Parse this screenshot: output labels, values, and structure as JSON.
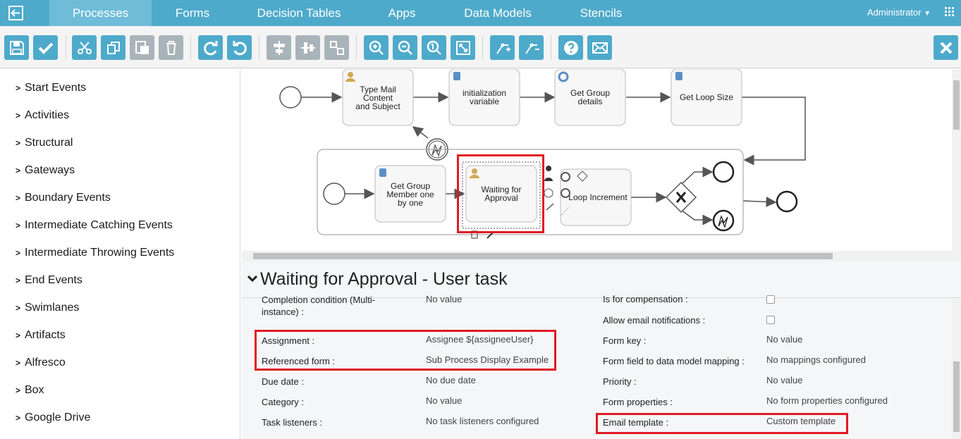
{
  "nav": {
    "tabs": [
      "Processes",
      "Forms",
      "Decision Tables",
      "Apps",
      "Data Models",
      "Stencils"
    ],
    "user": "Administrator"
  },
  "palette": {
    "items": [
      "Start Events",
      "Activities",
      "Structural",
      "Gateways",
      "Boundary Events",
      "Intermediate Catching Events",
      "Intermediate Throwing Events",
      "End Events",
      "Swimlanes",
      "Artifacts",
      "Alfresco",
      "Box",
      "Google Drive"
    ]
  },
  "diagram": {
    "task1": [
      "Type Mail",
      "Content",
      "and Subject"
    ],
    "task2": [
      "initialization",
      "variable"
    ],
    "task3": [
      "Get Group",
      "details"
    ],
    "task4": "Get Loop Size",
    "task5": [
      "Get Group",
      "Member one",
      "by one"
    ],
    "task6": [
      "Waiting for",
      "Approval"
    ],
    "task7": "Loop Increment"
  },
  "props": {
    "title": "Waiting for Approval - User task",
    "left": [
      {
        "label": "Completion condition (Multi-\ninstance) :",
        "value": "No value"
      },
      {
        "label": "Assignment :",
        "value": "Assignee ${assigneeUser}"
      },
      {
        "label": "Referenced form :",
        "value": "Sub Process Display Example"
      },
      {
        "label": "Due date :",
        "value": "No due date"
      },
      {
        "label": "Category :",
        "value": "No value"
      },
      {
        "label": "Task listeners :",
        "value": "No task listeners configured"
      }
    ],
    "right": [
      {
        "label": "Is for compensation :",
        "value": ""
      },
      {
        "label": "Allow email notifications :",
        "value": ""
      },
      {
        "label": "Form key :",
        "value": "No value"
      },
      {
        "label": "Form field to data model mapping :",
        "value": "No mappings configured"
      },
      {
        "label": "Priority :",
        "value": "No value"
      },
      {
        "label": "Form properties :",
        "value": "No form properties configured"
      },
      {
        "label": "Email template :",
        "value": "Custom template"
      }
    ]
  },
  "colors": {
    "accent": "#4eaacb",
    "highlight": "#e01b24"
  }
}
